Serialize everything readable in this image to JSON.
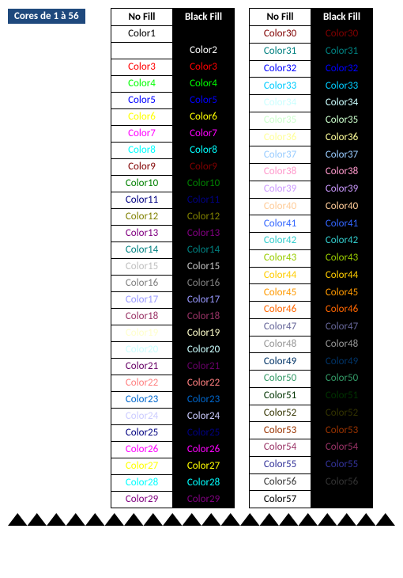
{
  "title": "Cores de 1 à 56",
  "headers": {
    "nofill": "No Fill",
    "blackfill": "Black Fill"
  },
  "palette": {
    "1": "#000000",
    "2": "#ffffff",
    "3": "#ff0000",
    "4": "#00ff00",
    "5": "#0000ff",
    "6": "#ffff00",
    "7": "#ff00ff",
    "8": "#00ffff",
    "9": "#800000",
    "10": "#008000",
    "11": "#000080",
    "12": "#808000",
    "13": "#800080",
    "14": "#008080",
    "15": "#c0c0c0",
    "16": "#808080",
    "17": "#9999ff",
    "18": "#993366",
    "19": "#ffffcc",
    "20": "#ccffff",
    "21": "#660066",
    "22": "#ff8080",
    "23": "#0066cc",
    "24": "#ccccff",
    "25": "#000080",
    "26": "#ff00ff",
    "27": "#ffff00",
    "28": "#00ffff",
    "29": "#800080",
    "30": "#800000",
    "31": "#008080",
    "32": "#0000ff",
    "33": "#00ccff",
    "34": "#ccffff",
    "35": "#ccffcc",
    "36": "#ffff99",
    "37": "#99ccff",
    "38": "#ff99cc",
    "39": "#cc99ff",
    "40": "#ffcc99",
    "41": "#3366ff",
    "42": "#33cccc",
    "43": "#99cc00",
    "44": "#ffcc00",
    "45": "#ff9900",
    "46": "#ff6600",
    "47": "#666699",
    "48": "#969696",
    "49": "#003366",
    "50": "#339966",
    "51": "#003300",
    "52": "#333300",
    "53": "#993300",
    "54": "#993366",
    "55": "#333399",
    "56": "#333333",
    "57": "#000000"
  },
  "labelPrefix": "Color",
  "leftRange": {
    "start": 1,
    "end": 29
  },
  "rightRange": {
    "start": 30,
    "end": 57
  },
  "chart_data": {
    "type": "table",
    "title": "Cores de 1 à 56",
    "columns": [
      "Index",
      "Hex",
      "Label"
    ],
    "rows": [
      [
        1,
        "#000000",
        "Color1"
      ],
      [
        2,
        "#ffffff",
        "Color2"
      ],
      [
        3,
        "#ff0000",
        "Color3"
      ],
      [
        4,
        "#00ff00",
        "Color4"
      ],
      [
        5,
        "#0000ff",
        "Color5"
      ],
      [
        6,
        "#ffff00",
        "Color6"
      ],
      [
        7,
        "#ff00ff",
        "Color7"
      ],
      [
        8,
        "#00ffff",
        "Color8"
      ],
      [
        9,
        "#800000",
        "Color9"
      ],
      [
        10,
        "#008000",
        "Color10"
      ],
      [
        11,
        "#000080",
        "Color11"
      ],
      [
        12,
        "#808000",
        "Color12"
      ],
      [
        13,
        "#800080",
        "Color13"
      ],
      [
        14,
        "#008080",
        "Color14"
      ],
      [
        15,
        "#c0c0c0",
        "Color15"
      ],
      [
        16,
        "#808080",
        "Color16"
      ],
      [
        17,
        "#9999ff",
        "Color17"
      ],
      [
        18,
        "#993366",
        "Color18"
      ],
      [
        19,
        "#ffffcc",
        "Color19"
      ],
      [
        20,
        "#ccffff",
        "Color20"
      ],
      [
        21,
        "#660066",
        "Color21"
      ],
      [
        22,
        "#ff8080",
        "Color22"
      ],
      [
        23,
        "#0066cc",
        "Color23"
      ],
      [
        24,
        "#ccccff",
        "Color24"
      ],
      [
        25,
        "#000080",
        "Color25"
      ],
      [
        26,
        "#ff00ff",
        "Color26"
      ],
      [
        27,
        "#ffff00",
        "Color27"
      ],
      [
        28,
        "#00ffff",
        "Color28"
      ],
      [
        29,
        "#800080",
        "Color29"
      ],
      [
        30,
        "#800000",
        "Color30"
      ],
      [
        31,
        "#008080",
        "Color31"
      ],
      [
        32,
        "#0000ff",
        "Color32"
      ],
      [
        33,
        "#00ccff",
        "Color33"
      ],
      [
        34,
        "#ccffff",
        "Color34"
      ],
      [
        35,
        "#ccffcc",
        "Color35"
      ],
      [
        36,
        "#ffff99",
        "Color36"
      ],
      [
        37,
        "#99ccff",
        "Color37"
      ],
      [
        38,
        "#ff99cc",
        "Color38"
      ],
      [
        39,
        "#cc99ff",
        "Color39"
      ],
      [
        40,
        "#ffcc99",
        "Color40"
      ],
      [
        41,
        "#3366ff",
        "Color41"
      ],
      [
        42,
        "#33cccc",
        "Color42"
      ],
      [
        43,
        "#99cc00",
        "Color43"
      ],
      [
        44,
        "#ffcc00",
        "Color44"
      ],
      [
        45,
        "#ff9900",
        "Color45"
      ],
      [
        46,
        "#ff6600",
        "Color46"
      ],
      [
        47,
        "#666699",
        "Color47"
      ],
      [
        48,
        "#969696",
        "Color48"
      ],
      [
        49,
        "#003366",
        "Color49"
      ],
      [
        50,
        "#339966",
        "Color50"
      ],
      [
        51,
        "#003300",
        "Color51"
      ],
      [
        52,
        "#333300",
        "Color52"
      ],
      [
        53,
        "#993300",
        "Color53"
      ],
      [
        54,
        "#993366",
        "Color54"
      ],
      [
        55,
        "#333399",
        "Color55"
      ],
      [
        56,
        "#333333",
        "Color56"
      ],
      [
        57,
        "#000000",
        "Color57"
      ]
    ]
  }
}
